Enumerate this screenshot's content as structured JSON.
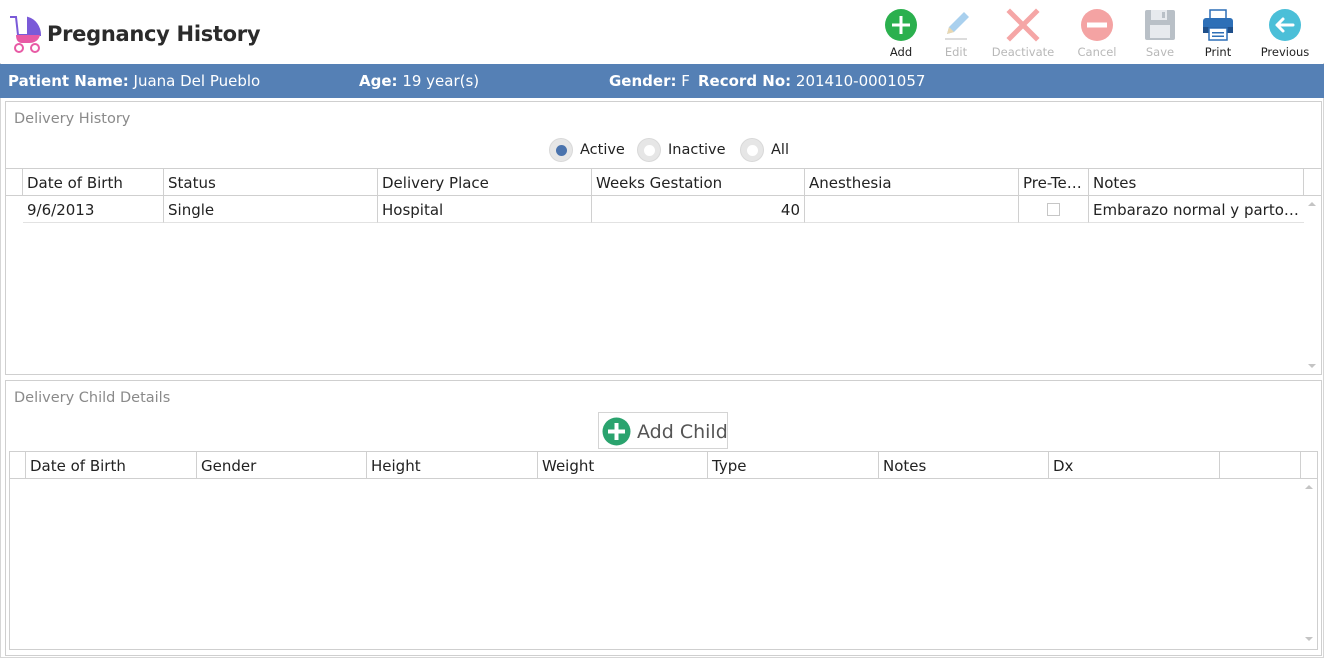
{
  "header": {
    "title": "Pregnancy History",
    "toolbar": [
      {
        "key": "add",
        "label": "Add",
        "icon": "plus-circle-icon",
        "color": "#2bb04e",
        "enabled": true
      },
      {
        "key": "edit",
        "label": "Edit",
        "icon": "pencil-icon",
        "color": "#9cc7e8",
        "enabled": false
      },
      {
        "key": "deactivate",
        "label": "Deactivate",
        "icon": "x-mark-icon",
        "color": "#f5a0a0",
        "enabled": false
      },
      {
        "key": "cancel",
        "label": "Cancel",
        "icon": "minus-circle-icon",
        "color": "#f4a3a3",
        "enabled": false
      },
      {
        "key": "save",
        "label": "Save",
        "icon": "floppy-disk-icon",
        "color": "#b9c0c7",
        "enabled": false
      },
      {
        "key": "print",
        "label": "Print",
        "icon": "printer-icon",
        "color": "#2d6fb7",
        "enabled": true
      },
      {
        "key": "previous",
        "label": "Previous",
        "icon": "arrow-left-circle-icon",
        "color": "#4bbfd8",
        "enabled": true
      }
    ]
  },
  "patient": {
    "name_label": "Patient Name:",
    "name": "Juana Del Pueblo",
    "age_label": "Age:",
    "age": "19 year(s)",
    "gender_label": "Gender:",
    "gender": "F",
    "record_label": "Record No:",
    "record": "201410-0001057"
  },
  "delivery_history": {
    "title": "Delivery History",
    "filters": [
      {
        "label": "Active",
        "checked": true
      },
      {
        "label": "Inactive",
        "checked": false
      },
      {
        "label": "All",
        "checked": false
      }
    ],
    "columns": [
      "Date of Birth",
      "Status",
      "Delivery Place",
      "Weeks Gestation",
      "Anesthesia",
      "Pre-Ter...",
      "Notes"
    ],
    "rows": [
      {
        "date_of_birth": "9/6/2013",
        "status": "Single",
        "delivery_place": "Hospital",
        "weeks_gestation": "40",
        "anesthesia": "",
        "pre_term": false,
        "notes": "Embarazo normal y parto sin complicaciones"
      }
    ]
  },
  "child_details": {
    "title": "Delivery Child Details",
    "add_child_label": "Add Child",
    "columns": [
      "Date of Birth",
      "Gender",
      "Height",
      "Weight",
      "Type",
      "Notes",
      "Dx",
      ""
    ],
    "rows": []
  },
  "colors": {
    "accent_bar": "#5580b5",
    "radio_selected": "#4a73ad",
    "add_green": "#2bb04e"
  }
}
